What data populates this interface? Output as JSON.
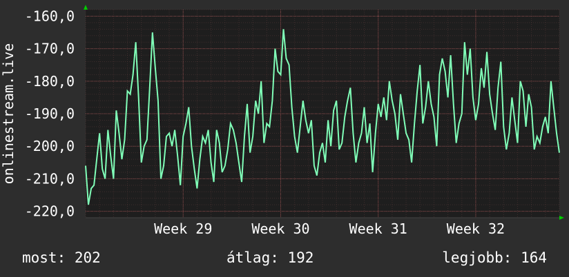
{
  "chart_data": {
    "type": "line",
    "ylabel": "onlinestream.live",
    "ylim": [
      -222,
      -158
    ],
    "yticks": [
      -160,
      -170,
      -180,
      -190,
      -200,
      -210,
      -220
    ],
    "ytick_labels": [
      "-160,0",
      "-170,0",
      "-180,0",
      "-190,0",
      "-200,0",
      "-210,0",
      "-220,0"
    ],
    "xlim": [
      0,
      34
    ],
    "xticks": [
      {
        "label": "Week 29",
        "x": 7
      },
      {
        "label": "Week 30",
        "x": 14
      },
      {
        "label": "Week 31",
        "x": 21
      },
      {
        "label": "Week 32",
        "x": 28
      }
    ],
    "grid": true,
    "colors": {
      "background": "#2d2d2d",
      "plot": "#1e1e1e",
      "grid": "#5a3a3a",
      "line": "#80ffb8",
      "arrow": "#00cc00"
    },
    "series": [
      {
        "values": [
          [
            0.0,
            -206
          ],
          [
            0.2,
            -218
          ],
          [
            0.4,
            -213
          ],
          [
            0.6,
            -212
          ],
          [
            0.8,
            -204
          ],
          [
            1.0,
            -196
          ],
          [
            1.2,
            -207
          ],
          [
            1.4,
            -210
          ],
          [
            1.6,
            -195
          ],
          [
            1.8,
            -203
          ],
          [
            2.0,
            -210
          ],
          [
            2.2,
            -189
          ],
          [
            2.4,
            -196
          ],
          [
            2.6,
            -204
          ],
          [
            2.8,
            -198
          ],
          [
            3.0,
            -183
          ],
          [
            3.2,
            -184
          ],
          [
            3.4,
            -178
          ],
          [
            3.6,
            -168
          ],
          [
            3.8,
            -185
          ],
          [
            4.0,
            -205
          ],
          [
            4.2,
            -200
          ],
          [
            4.4,
            -198
          ],
          [
            4.6,
            -182
          ],
          [
            4.8,
            -165
          ],
          [
            5.0,
            -176
          ],
          [
            5.2,
            -186
          ],
          [
            5.4,
            -210
          ],
          [
            5.6,
            -206
          ],
          [
            5.8,
            -197
          ],
          [
            6.0,
            -196
          ],
          [
            6.2,
            -200
          ],
          [
            6.4,
            -195
          ],
          [
            6.6,
            -203
          ],
          [
            6.8,
            -212
          ],
          [
            7.0,
            -197
          ],
          [
            7.2,
            -193
          ],
          [
            7.4,
            -188
          ],
          [
            7.6,
            -200
          ],
          [
            7.8,
            -207
          ],
          [
            8.0,
            -213
          ],
          [
            8.2,
            -204
          ],
          [
            8.4,
            -197
          ],
          [
            8.6,
            -199
          ],
          [
            8.8,
            -195
          ],
          [
            9.0,
            -205
          ],
          [
            9.2,
            -211
          ],
          [
            9.4,
            -195
          ],
          [
            9.6,
            -199
          ],
          [
            9.8,
            -208
          ],
          [
            10.0,
            -206
          ],
          [
            10.2,
            -201
          ],
          [
            10.4,
            -193
          ],
          [
            10.6,
            -195
          ],
          [
            10.8,
            -199
          ],
          [
            11.0,
            -205
          ],
          [
            11.2,
            -211
          ],
          [
            11.4,
            -197
          ],
          [
            11.6,
            -187
          ],
          [
            11.8,
            -202
          ],
          [
            12.0,
            -197
          ],
          [
            12.2,
            -186
          ],
          [
            12.4,
            -190
          ],
          [
            12.6,
            -180
          ],
          [
            12.8,
            -199
          ],
          [
            13.0,
            -193
          ],
          [
            13.2,
            -194
          ],
          [
            13.4,
            -186
          ],
          [
            13.6,
            -170
          ],
          [
            13.8,
            -177
          ],
          [
            14.0,
            -178
          ],
          [
            14.2,
            -164
          ],
          [
            14.4,
            -173
          ],
          [
            14.6,
            -175
          ],
          [
            14.8,
            -188
          ],
          [
            15.0,
            -197
          ],
          [
            15.2,
            -202
          ],
          [
            15.4,
            -194
          ],
          [
            15.6,
            -186
          ],
          [
            15.8,
            -192
          ],
          [
            16.0,
            -196
          ],
          [
            16.2,
            -192
          ],
          [
            16.4,
            -206
          ],
          [
            16.6,
            -209
          ],
          [
            16.8,
            -202
          ],
          [
            17.0,
            -199
          ],
          [
            17.2,
            -205
          ],
          [
            17.4,
            -192
          ],
          [
            17.6,
            -200
          ],
          [
            17.8,
            -189
          ],
          [
            18.0,
            -186
          ],
          [
            18.2,
            -201
          ],
          [
            18.4,
            -199
          ],
          [
            18.6,
            -191
          ],
          [
            18.8,
            -186
          ],
          [
            19.0,
            -182
          ],
          [
            19.2,
            -196
          ],
          [
            19.4,
            -205
          ],
          [
            19.6,
            -199
          ],
          [
            19.8,
            -196
          ],
          [
            20.0,
            -188
          ],
          [
            20.2,
            -199
          ],
          [
            20.4,
            -193
          ],
          [
            20.6,
            -208
          ],
          [
            20.8,
            -196
          ],
          [
            21.0,
            -187
          ],
          [
            21.2,
            -191
          ],
          [
            21.4,
            -185
          ],
          [
            21.6,
            -192
          ],
          [
            21.8,
            -180
          ],
          [
            22.0,
            -186
          ],
          [
            22.2,
            -190
          ],
          [
            22.4,
            -198
          ],
          [
            22.6,
            -184
          ],
          [
            22.8,
            -190
          ],
          [
            23.0,
            -196
          ],
          [
            23.2,
            -198
          ],
          [
            23.4,
            -205
          ],
          [
            23.6,
            -193
          ],
          [
            23.8,
            -183
          ],
          [
            24.0,
            -175
          ],
          [
            24.2,
            -193
          ],
          [
            24.4,
            -188
          ],
          [
            24.6,
            -180
          ],
          [
            24.8,
            -187
          ],
          [
            25.0,
            -191
          ],
          [
            25.2,
            -200
          ],
          [
            25.4,
            -178
          ],
          [
            25.6,
            -173
          ],
          [
            25.8,
            -177
          ],
          [
            26.0,
            -185
          ],
          [
            26.2,
            -172
          ],
          [
            26.4,
            -187
          ],
          [
            26.6,
            -199
          ],
          [
            26.8,
            -193
          ],
          [
            27.0,
            -190
          ],
          [
            27.2,
            -168
          ],
          [
            27.4,
            -178
          ],
          [
            27.6,
            -170
          ],
          [
            27.8,
            -185
          ],
          [
            28.0,
            -192
          ],
          [
            28.2,
            -187
          ],
          [
            28.4,
            -176
          ],
          [
            28.6,
            -182
          ],
          [
            28.8,
            -171
          ],
          [
            29.0,
            -184
          ],
          [
            29.2,
            -190
          ],
          [
            29.4,
            -195
          ],
          [
            29.6,
            -182
          ],
          [
            29.8,
            -174
          ],
          [
            30.0,
            -194
          ],
          [
            30.2,
            -201
          ],
          [
            30.4,
            -196
          ],
          [
            30.6,
            -185
          ],
          [
            30.8,
            -192
          ],
          [
            31.0,
            -199
          ],
          [
            31.2,
            -180
          ],
          [
            31.4,
            -183
          ],
          [
            31.6,
            -194
          ],
          [
            31.8,
            -184
          ],
          [
            32.0,
            -188
          ],
          [
            32.2,
            -201
          ],
          [
            32.4,
            -197
          ],
          [
            32.6,
            -199
          ],
          [
            32.8,
            -194
          ],
          [
            33.0,
            -191
          ],
          [
            33.2,
            -196
          ],
          [
            33.4,
            -180
          ],
          [
            33.6,
            -188
          ],
          [
            33.8,
            -196
          ],
          [
            34.0,
            -202
          ]
        ]
      }
    ]
  },
  "stats": {
    "now": "most: 202",
    "avg": "átlag: 192",
    "best": "legjobb: 164"
  }
}
